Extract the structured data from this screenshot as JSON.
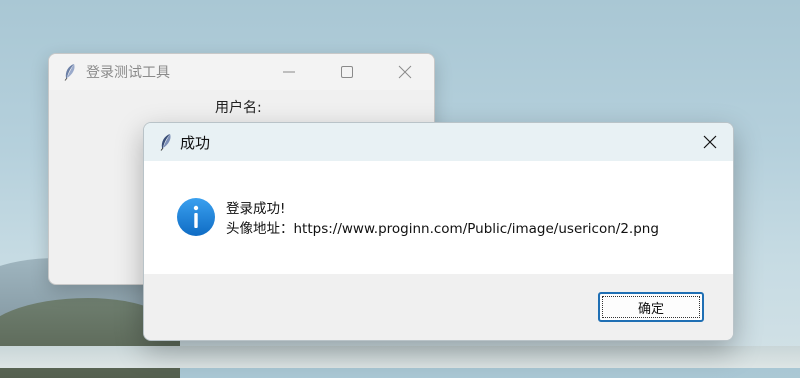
{
  "background_window": {
    "title": "登录测试工具",
    "username_label": "用户名:",
    "controls": [
      "minimize-icon",
      "maximize-icon",
      "close-icon"
    ]
  },
  "dialog": {
    "title": "成功",
    "icon": "info-icon",
    "message_line1": "登录成功!",
    "message_line2": "头像地址：https://www.proginn.com/Public/image/usericon/2.png",
    "ok_label": "确定"
  },
  "colors": {
    "accent": "#1f6fb4",
    "info_icon": "#1a7fd6",
    "dialog_titlebar": "#e8f1f4"
  }
}
